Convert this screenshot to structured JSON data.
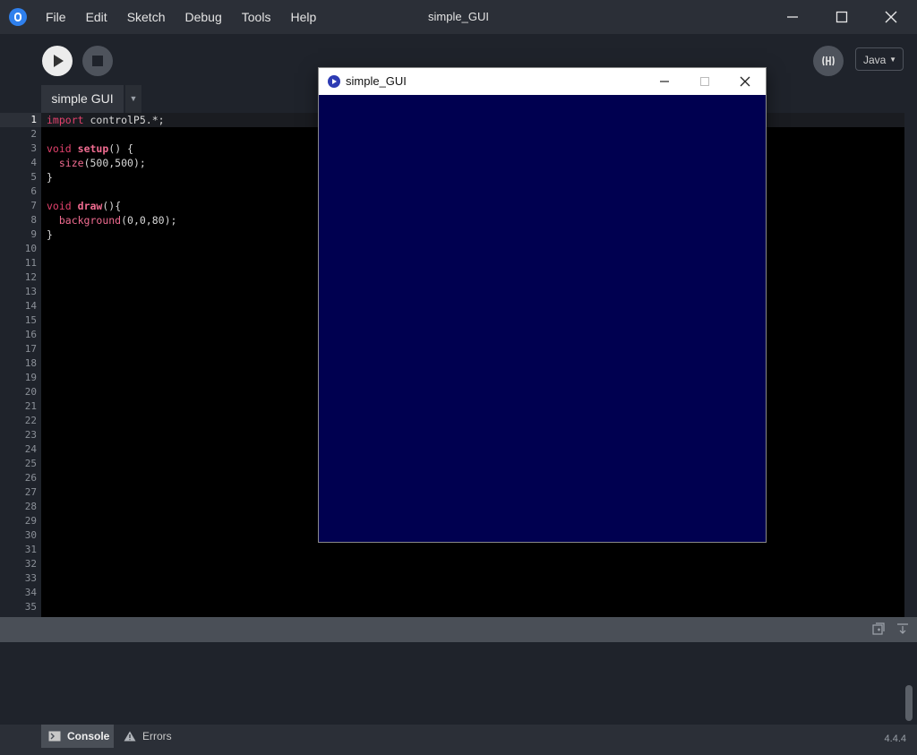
{
  "window": {
    "title": "simple_GUI",
    "menu": [
      "File",
      "Edit",
      "Sketch",
      "Debug",
      "Tools",
      "Help"
    ]
  },
  "toolbar": {
    "mode": "Java"
  },
  "tabs": [
    {
      "label": "simple GUI"
    }
  ],
  "editor": {
    "current_line": 1,
    "line_count": 35,
    "lines": [
      "import controlP5.*;",
      "",
      "void setup() {",
      "  size(500,500);",
      "}",
      "",
      "void draw(){",
      "  background(0,0,80);",
      "}"
    ]
  },
  "console_tabs": [
    {
      "label": "Console",
      "icon": "terminal-icon",
      "active": true
    },
    {
      "label": "Errors",
      "icon": "warning-icon",
      "active": false
    }
  ],
  "status": {
    "version": "4.4.4"
  },
  "sketch_window": {
    "title": "simple_GUI",
    "background_color": "#000050"
  }
}
